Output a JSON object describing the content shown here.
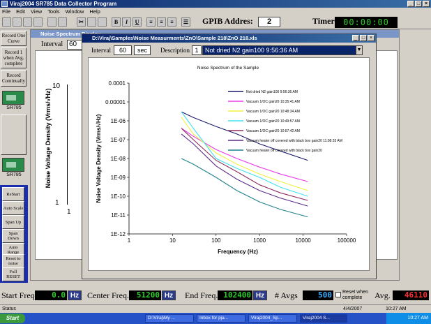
{
  "app": {
    "title": "Viraj2004 SR785 Data Collector Program"
  },
  "menu": [
    "File",
    "Edit",
    "View",
    "Tools",
    "Window",
    "Help"
  ],
  "toolbar": {
    "gpib_label": "GPIB Addres:",
    "gpib_value": "2",
    "timer_label": "Timer",
    "timer_value": "00:00:00"
  },
  "left_buttons": {
    "record_one": "Record One Curve",
    "record_avg": "Record 1 when Avg. complete",
    "record_cont": "Record Continually",
    "instrument": "SR785"
  },
  "control_buttons": [
    "ReStart",
    "Auto Scale",
    "Span Up",
    "Span Down",
    "Auto Range",
    "Reset to noise",
    "Full RESET"
  ],
  "bg_window": {
    "title": "Noise Spectrum Display",
    "interval_label": "Interval",
    "interval_value": "60",
    "y_tick_top": "10",
    "y_tick_bottom": "1",
    "x_tick": "1",
    "ylabel": "Noise Voltage Density (Vrms/√Hz)"
  },
  "fg_window": {
    "title": "D:\\Viraj\\Samples\\Noise Measurments\\ZnO\\Sample 218\\ZnO 218.xls",
    "interval_label": "Interval",
    "interval_value": "60",
    "interval_unit": "sec",
    "description_label": "Description",
    "description_num": "1",
    "description_value": "Not dried N2 gain100 9:56:36 AM"
  },
  "chart_data": {
    "type": "line",
    "title": "Noise Spectrum of the Sample",
    "xlabel": "Frequency (Hz)",
    "ylabel": "Noise Voltage Density (Vrms/√Hz)",
    "x_scale": "log",
    "y_scale": "log",
    "xlim": [
      1,
      100000
    ],
    "ylim": [
      1e-12,
      0.0001
    ],
    "xticks": [
      "1",
      "10",
      "100",
      "1000",
      "10000",
      "100000"
    ],
    "yticks": [
      "0.0001",
      "0.00001",
      "1E-06",
      "1E-07",
      "1E-08",
      "1E-09",
      "1E-10",
      "1E-11",
      "1E-12"
    ],
    "legend_position": "top-right",
    "series": [
      {
        "name": "Not dried N2 gain100 9:56:36 AM",
        "color": "#1a1a6e",
        "x": [
          16,
          30,
          100,
          300,
          1000,
          3000,
          12800
        ],
        "y": [
          3e-06,
          1.5e-06,
          5e-07,
          2e-07,
          6e-08,
          2.5e-08,
          8e-09
        ]
      },
      {
        "name": "Vacuum 1/OC gain20 10:35:41 AM",
        "color": "#e838e8",
        "x": [
          16,
          30,
          100,
          300,
          1000,
          3000,
          12800
        ],
        "y": [
          4e-07,
          1.5e-07,
          3e-08,
          1e-08,
          3.5e-09,
          1.5e-09,
          6e-10
        ]
      },
      {
        "name": "Vacuum 1/OC gain20 10:48:34 AM",
        "color": "#f0f040",
        "x": [
          16,
          30,
          100,
          300,
          1000,
          3000,
          12800
        ],
        "y": [
          1.5e-06,
          2e-07,
          2e-08,
          5e-09,
          1.5e-09,
          6e-10,
          2e-10
        ]
      },
      {
        "name": "Vacuum 1/OC gain20 10:49:57 AM",
        "color": "#40e0f0",
        "x": [
          16,
          30,
          100,
          300,
          1000,
          3000,
          12800
        ],
        "y": [
          3e-06,
          4e-07,
          1e-08,
          3e-09,
          1e-09,
          3e-10,
          1e-10
        ]
      },
      {
        "name": "Vacuum 1/OC gain20 10:57:42 AM",
        "color": "#8b2a5a",
        "x": [
          16,
          30,
          100,
          300,
          1000,
          3000,
          12800
        ],
        "y": [
          4e-07,
          1e-07,
          8e-09,
          2e-09,
          4e-10,
          1.5e-10,
          6e-11
        ]
      },
      {
        "name": "Vacuum heater off covered with black box gain20 11:08:33 AM",
        "color": "#5a2a8a",
        "x": [
          16,
          30,
          100,
          300,
          1000,
          3000,
          12800
        ],
        "y": [
          2e-07,
          6e-08,
          4e-09,
          8e-10,
          2e-10,
          8e-11,
          3e-11
        ]
      },
      {
        "name": "Vacuum heater off covered with black box gain20",
        "color": "#20808a",
        "x": [
          16,
          30,
          100,
          300,
          1000,
          3000,
          12800
        ],
        "y": [
          1e-08,
          5e-09,
          1e-09,
          2e-10,
          5e-11,
          2e-11,
          8e-12
        ]
      }
    ]
  },
  "bottom": {
    "start_label": "Start Freq.",
    "start_value": "0.0",
    "start_unit": "Hz",
    "center_label": "Center Freq.",
    "center_value": "51200",
    "center_unit": "Hz",
    "end_label": "End Freq.",
    "end_value": "102400",
    "end_unit": "Hz",
    "avgs_label": "# Avgs",
    "avgs_value": "500",
    "reset_label": "Reset when complete",
    "avg_label": "Avg.",
    "avg_value": "46110"
  },
  "statusbar": {
    "text": "Status",
    "date": "4/4/2007",
    "time": "10:27 AM"
  },
  "taskbar": {
    "start": "Start",
    "tasks": [
      "D:\\Viraj\\My ...",
      "Inbox for pja...",
      "Viraj2004_Sp...",
      "Viraj2004 S..."
    ],
    "clock": "10:27 AM"
  }
}
